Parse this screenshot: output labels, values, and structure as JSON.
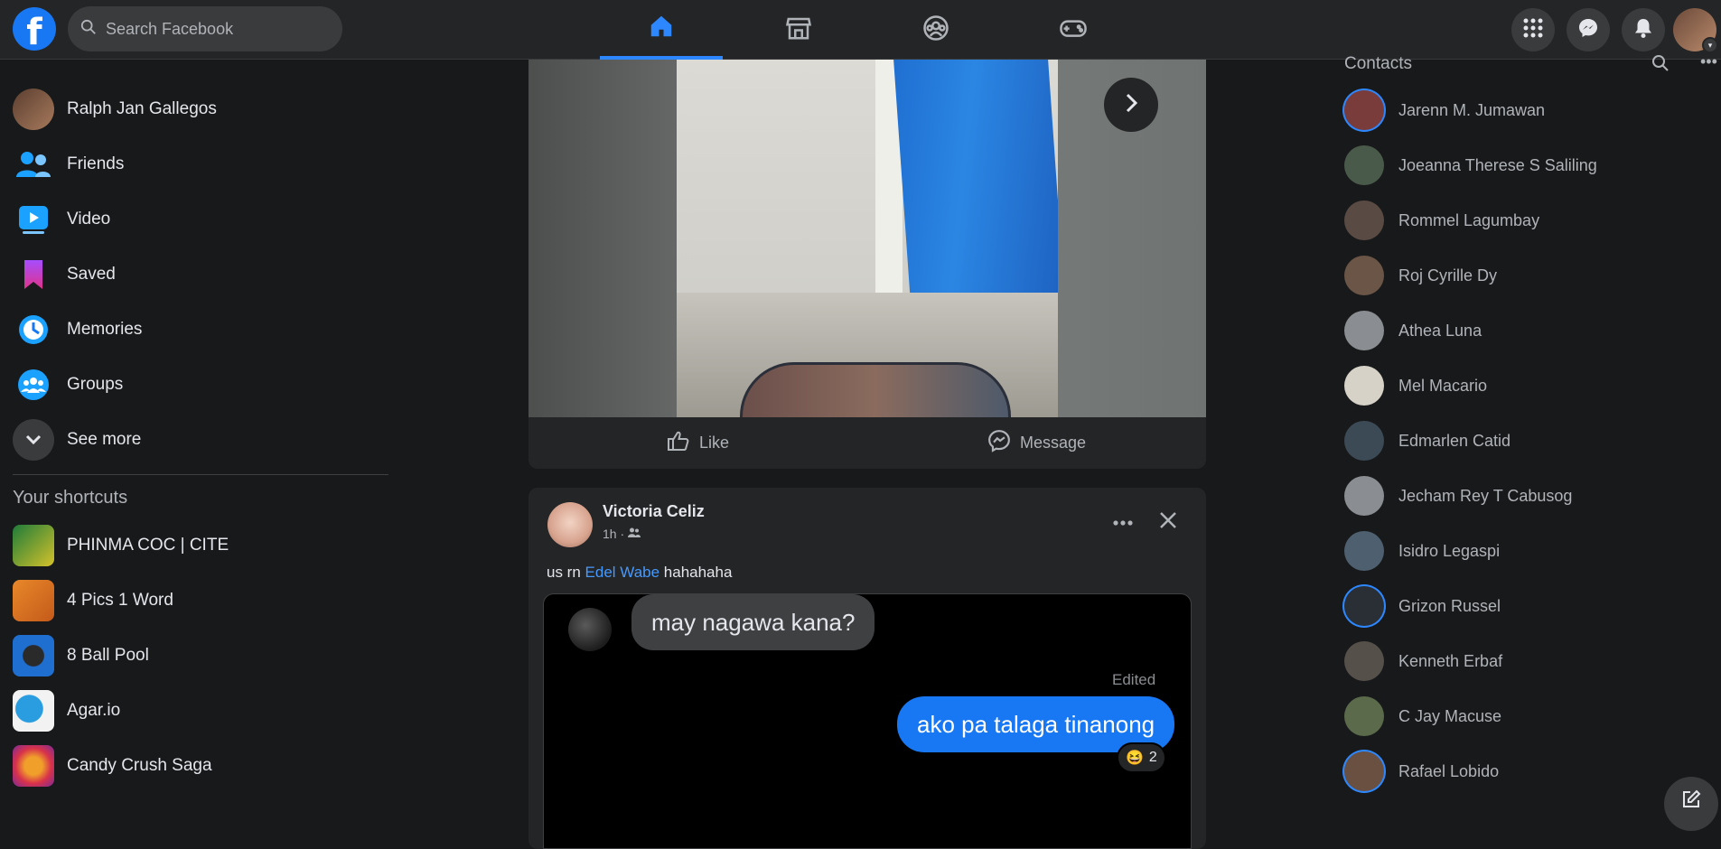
{
  "topbar": {
    "logo_letter": "f",
    "search_placeholder": "Search Facebook",
    "nav_tabs": [
      {
        "name": "home",
        "active": true
      },
      {
        "name": "marketplace",
        "active": false
      },
      {
        "name": "groups",
        "active": false
      },
      {
        "name": "gaming",
        "active": false
      }
    ],
    "right_buttons": [
      "menu-grid-icon",
      "messenger-icon",
      "notifications-icon"
    ]
  },
  "leftnav": {
    "items": [
      {
        "label": "Ralph Jan Gallegos",
        "icon": "profile-avatar"
      },
      {
        "label": "Friends",
        "icon": "friends-icon"
      },
      {
        "label": "Video",
        "icon": "video-icon"
      },
      {
        "label": "Saved",
        "icon": "saved-icon"
      },
      {
        "label": "Memories",
        "icon": "memories-icon"
      },
      {
        "label": "Groups",
        "icon": "groups-icon"
      },
      {
        "label": "See more",
        "icon": "chevron-down-icon"
      }
    ],
    "shortcuts_title": "Your shortcuts",
    "shortcuts": [
      {
        "label": "PHINMA COC | CITE",
        "color": "#1e7b3a"
      },
      {
        "label": "4 Pics 1 Word",
        "color": "#e8882a"
      },
      {
        "label": "8 Ball Pool",
        "color": "#1f6fd1"
      },
      {
        "label": "Agar.io",
        "color": "#2a9de0"
      },
      {
        "label": "Candy Crush Saga",
        "color": "#d8324a"
      }
    ]
  },
  "post1": {
    "like_label": "Like",
    "message_label": "Message"
  },
  "post2": {
    "author": "Victoria Celiz",
    "time": "1h ·",
    "text_before": "us rn ",
    "tagged": "Edel Wabe",
    "text_after": " hahahaha",
    "chat": {
      "incoming": "may nagawa kana?",
      "edited_label": "Edited",
      "outgoing": "ako pa talaga tinanong",
      "reaction_emoji": "😆",
      "reaction_count": "2"
    }
  },
  "contacts": {
    "title": "Contacts",
    "list": [
      {
        "name": "Jarenn M. Jumawan",
        "ring": true,
        "color": "#7a3b3b"
      },
      {
        "name": "Joeanna Therese S Saliling",
        "ring": false,
        "color": "#4a5a4a"
      },
      {
        "name": "Rommel Lagumbay",
        "ring": false,
        "color": "#5a4a44"
      },
      {
        "name": "Roj Cyrille Dy",
        "ring": false,
        "color": "#6b5546"
      },
      {
        "name": "Athea Luna",
        "ring": false,
        "color": "#8a8d91"
      },
      {
        "name": "Mel Macario",
        "ring": false,
        "color": "#d6d2c8"
      },
      {
        "name": "Edmarlen Catid",
        "ring": false,
        "color": "#3c4a55"
      },
      {
        "name": "Jecham Rey T Cabusog",
        "ring": false,
        "color": "#8a8d91"
      },
      {
        "name": "Isidro Legaspi",
        "ring": false,
        "color": "#4e6070"
      },
      {
        "name": "Grizon Russel",
        "ring": true,
        "color": "#2a2f35"
      },
      {
        "name": "Kenneth Erbaf",
        "ring": false,
        "color": "#55504a"
      },
      {
        "name": "C Jay Macuse",
        "ring": false,
        "color": "#5a6a4a"
      },
      {
        "name": "Rafael Lobido",
        "ring": true,
        "color": "#6a5040"
      }
    ]
  }
}
